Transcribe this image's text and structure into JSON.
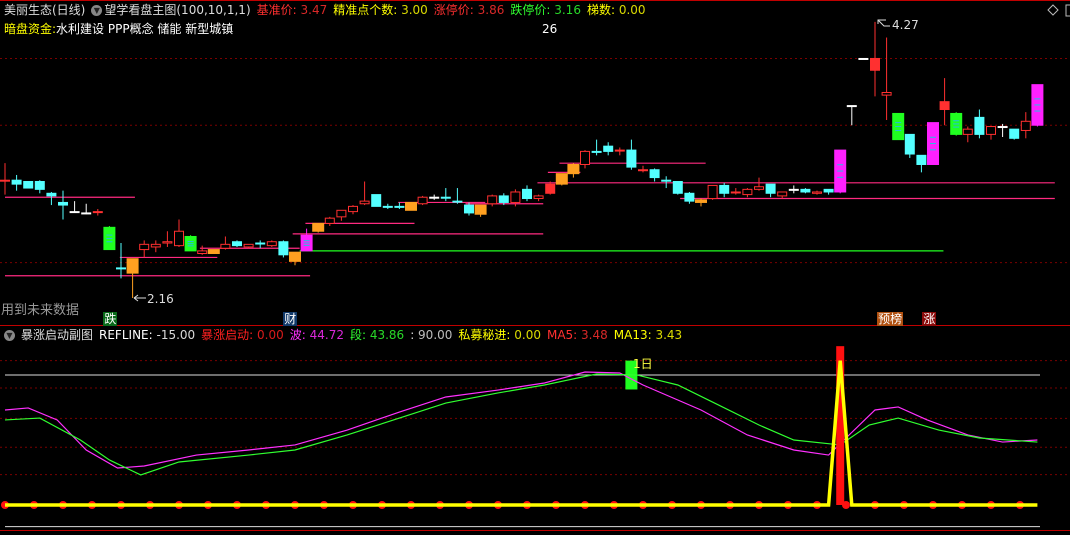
{
  "header": {
    "stock": "美丽生态(日线)",
    "indicator": "望学看盘主图(100,10,1,1)",
    "items": [
      {
        "label": "基准价: ",
        "value": "3.47",
        "color": "#ff3030"
      },
      {
        "label": "精准点个数: ",
        "value": "3.00",
        "color": "#ffff00"
      },
      {
        "label": "涨停价: ",
        "value": "3.86",
        "color": "#ff3030"
      },
      {
        "label": "跌停价: ",
        "value": "3.16",
        "color": "#30ff30"
      },
      {
        "label": "梯数: ",
        "value": "0.00",
        "color": "#ffff00"
      }
    ],
    "concept_label": "暗盘资金:",
    "concepts": "水利建设 PPP概念 储能 新型城镇",
    "number": "26"
  },
  "sub_header": {
    "title": "暴涨启动副图",
    "items": [
      {
        "label": "REFLINE: ",
        "value": "-15.00",
        "color": "#ffffff"
      },
      {
        "label": "暴涨启动: ",
        "value": "0.00",
        "color": "#ff2020"
      },
      {
        "label": "波: ",
        "value": "44.72",
        "color": "#ff30ff"
      },
      {
        "label": "段: ",
        "value": "43.86",
        "color": "#30ff30"
      },
      {
        "label": ": ",
        "value": "90.00",
        "color": "#dddddd"
      },
      {
        "label": "私募秘进: ",
        "value": "0.00",
        "color": "#ffff00"
      },
      {
        "label": "MA5: ",
        "value": "3.48",
        "color": "#ff3030"
      },
      {
        "label": "MA13: ",
        "value": "3.43",
        "color": "#ffff00"
      }
    ]
  },
  "annotations": {
    "high_label": "4.27",
    "low_label": "2.16",
    "future_data_note": "用到未来数据",
    "tags": [
      {
        "text": "跌",
        "bg": "#0a6a1a",
        "index": 9
      },
      {
        "text": "财",
        "bg": "#123a6a",
        "index": 24.5
      },
      {
        "text": "预榜",
        "bg": "#b05010",
        "index": 75.7
      },
      {
        "text": "涨",
        "bg": "#8a0a0a",
        "index": 79.6
      }
    ],
    "sub_marker_label": "1日"
  },
  "colors": {
    "up": "#ff3030",
    "down": "#54ffff",
    "flat": "#ffffff",
    "orange": "#ffa020",
    "green": "#20ff20",
    "magenta": "#ff20ff",
    "level": "#ff2a80",
    "grid": "#7a0000"
  },
  "chart_data": [
    {
      "type": "candlestick",
      "ylim": [
        1.95,
        4.44
      ],
      "high_point": 4.27,
      "low_point": 2.16,
      "candle_fields": [
        "open",
        "high",
        "low",
        "close",
        "style"
      ],
      "candles": [
        [
          3.06,
          3.19,
          2.95,
          3.06,
          "up"
        ],
        [
          3.06,
          3.1,
          2.98,
          3.03,
          "dn"
        ],
        [
          3.05,
          3.05,
          3.0,
          3.0,
          "dn"
        ],
        [
          3.05,
          3.06,
          2.96,
          2.99,
          "dn"
        ],
        [
          2.96,
          2.97,
          2.87,
          2.94,
          "dn"
        ],
        [
          2.89,
          2.98,
          2.76,
          2.87,
          "dn"
        ],
        [
          2.82,
          2.9,
          2.82,
          2.82,
          "flat"
        ],
        [
          2.81,
          2.88,
          2.8,
          2.81,
          "flat"
        ],
        [
          2.82,
          2.84,
          2.79,
          2.82,
          "up"
        ],
        [
          2.7,
          2.71,
          2.53,
          2.53,
          "gr"
        ],
        [
          2.39,
          2.58,
          2.31,
          2.39,
          "dn"
        ],
        [
          2.35,
          2.46,
          2.16,
          2.46,
          "or"
        ],
        [
          2.53,
          2.6,
          2.47,
          2.57,
          "up"
        ],
        [
          2.55,
          2.6,
          2.51,
          2.57,
          "up"
        ],
        [
          2.58,
          2.67,
          2.55,
          2.59,
          "up"
        ],
        [
          2.56,
          2.76,
          2.55,
          2.67,
          "up"
        ],
        [
          2.63,
          2.64,
          2.52,
          2.52,
          "gr"
        ],
        [
          2.5,
          2.56,
          2.49,
          2.52,
          "up"
        ],
        [
          2.5,
          2.53,
          2.5,
          2.53,
          "or"
        ],
        [
          2.54,
          2.63,
          2.53,
          2.57,
          "up"
        ],
        [
          2.59,
          2.6,
          2.55,
          2.56,
          "dn"
        ],
        [
          2.55,
          2.57,
          2.54,
          2.57,
          "up"
        ],
        [
          2.58,
          2.6,
          2.54,
          2.58,
          "dn"
        ],
        [
          2.56,
          2.6,
          2.55,
          2.59,
          "up"
        ],
        [
          2.59,
          2.6,
          2.47,
          2.49,
          "dn"
        ],
        [
          2.51,
          2.51,
          2.41,
          2.44,
          "or"
        ],
        [
          2.52,
          2.69,
          2.52,
          2.64,
          "mg"
        ],
        [
          2.67,
          2.73,
          2.66,
          2.73,
          "or"
        ],
        [
          2.73,
          2.78,
          2.71,
          2.77,
          "up"
        ],
        [
          2.78,
          2.83,
          2.75,
          2.83,
          "up"
        ],
        [
          2.82,
          2.87,
          2.8,
          2.86,
          "up"
        ],
        [
          2.88,
          3.05,
          2.87,
          2.9,
          "up"
        ],
        [
          2.95,
          2.95,
          2.86,
          2.86,
          "dn"
        ],
        [
          2.86,
          2.88,
          2.84,
          2.86,
          "dn"
        ],
        [
          2.86,
          2.89,
          2.84,
          2.86,
          "dn"
        ],
        [
          2.83,
          2.89,
          2.83,
          2.89,
          "or"
        ],
        [
          2.88,
          2.94,
          2.87,
          2.93,
          "up"
        ],
        [
          2.93,
          2.95,
          2.91,
          2.93,
          "flat"
        ],
        [
          2.93,
          3.0,
          2.9,
          2.93,
          "dn"
        ],
        [
          2.9,
          3.0,
          2.88,
          2.9,
          "dn"
        ],
        [
          2.87,
          2.89,
          2.79,
          2.81,
          "dn"
        ],
        [
          2.8,
          2.87,
          2.78,
          2.87,
          "or"
        ],
        [
          2.88,
          2.95,
          2.86,
          2.94,
          "up"
        ],
        [
          2.94,
          2.96,
          2.87,
          2.89,
          "dn"
        ],
        [
          2.89,
          2.99,
          2.86,
          2.97,
          "up"
        ],
        [
          2.99,
          3.02,
          2.9,
          2.92,
          "dn"
        ],
        [
          2.92,
          2.95,
          2.9,
          2.94,
          "up"
        ],
        [
          2.96,
          3.05,
          2.95,
          3.03,
          "rf"
        ],
        [
          3.03,
          3.11,
          3.02,
          3.11,
          "or"
        ],
        [
          3.11,
          3.19,
          3.08,
          3.18,
          "or"
        ],
        [
          3.18,
          3.29,
          3.15,
          3.28,
          "up"
        ],
        [
          3.28,
          3.37,
          3.25,
          3.28,
          "dn"
        ],
        [
          3.32,
          3.35,
          3.25,
          3.28,
          "dn"
        ],
        [
          3.29,
          3.31,
          3.25,
          3.29,
          "up"
        ],
        [
          3.29,
          3.37,
          3.14,
          3.16,
          "dn"
        ],
        [
          3.14,
          3.17,
          3.12,
          3.14,
          "up"
        ],
        [
          3.14,
          3.15,
          3.05,
          3.08,
          "dn"
        ],
        [
          3.06,
          3.09,
          3.0,
          3.06,
          "dn"
        ],
        [
          3.05,
          3.05,
          2.95,
          2.96,
          "dn"
        ],
        [
          2.96,
          2.97,
          2.88,
          2.9,
          "dn"
        ],
        [
          2.89,
          2.92,
          2.86,
          2.91,
          "or"
        ],
        [
          2.92,
          3.02,
          2.91,
          3.02,
          "up"
        ],
        [
          3.02,
          3.04,
          2.93,
          2.96,
          "dn"
        ],
        [
          2.97,
          3.0,
          2.95,
          2.97,
          "up"
        ],
        [
          2.95,
          3.0,
          2.93,
          2.99,
          "up"
        ],
        [
          2.99,
          3.08,
          2.98,
          3.01,
          "up"
        ],
        [
          3.03,
          3.03,
          2.93,
          2.96,
          "dn"
        ],
        [
          2.94,
          2.97,
          2.92,
          2.97,
          "up"
        ],
        [
          2.99,
          3.02,
          2.96,
          2.99,
          "flat"
        ],
        [
          2.99,
          3.0,
          2.96,
          2.97,
          "dn"
        ],
        [
          2.96,
          2.98,
          2.95,
          2.97,
          "up"
        ],
        [
          2.99,
          2.99,
          2.95,
          2.97,
          "dn"
        ],
        [
          2.97,
          3.29,
          2.96,
          3.29,
          "mg"
        ],
        [
          3.63,
          3.63,
          3.48,
          3.63,
          "flat"
        ],
        [
          3.99,
          3.99,
          3.99,
          3.99,
          "flat"
        ],
        [
          3.9,
          4.27,
          3.7,
          3.99,
          "rf"
        ],
        [
          3.71,
          4.15,
          3.52,
          3.73,
          "up"
        ],
        [
          3.57,
          3.57,
          3.37,
          3.37,
          "gr"
        ],
        [
          3.41,
          3.41,
          3.23,
          3.26,
          "dn"
        ],
        [
          3.25,
          3.25,
          3.12,
          3.18,
          "dn"
        ],
        [
          3.18,
          3.5,
          3.18,
          3.5,
          "mg"
        ],
        [
          3.6,
          3.84,
          3.48,
          3.66,
          "rf"
        ],
        [
          3.57,
          3.58,
          3.4,
          3.41,
          "gr"
        ],
        [
          3.41,
          3.47,
          3.35,
          3.45,
          "up"
        ],
        [
          3.54,
          3.6,
          3.38,
          3.41,
          "dn"
        ],
        [
          3.41,
          3.47,
          3.37,
          3.47,
          "up"
        ],
        [
          3.47,
          3.49,
          3.39,
          3.47,
          "flat"
        ],
        [
          3.45,
          3.45,
          3.37,
          3.38,
          "dn"
        ],
        [
          3.44,
          3.58,
          3.38,
          3.51,
          "up"
        ],
        [
          3.48,
          3.79,
          3.47,
          3.79,
          "mg"
        ]
      ],
      "levels": [
        {
          "price": 2.93,
          "from": 0,
          "to": 11.2,
          "color": "#ff2a80"
        },
        {
          "price": 2.33,
          "from": 0,
          "to": 26.3,
          "color": "#ff2a80"
        },
        {
          "price": 2.47,
          "from": 9.9,
          "to": 18.3,
          "color": "#ff2a80"
        },
        {
          "price": 2.54,
          "from": 16.8,
          "to": 25.4,
          "color": "#ff2a80"
        },
        {
          "price": 2.73,
          "from": 25.9,
          "to": 35.3,
          "color": "#ff2a80"
        },
        {
          "price": 2.65,
          "from": 24.8,
          "to": 46.4,
          "color": "#ff2a80"
        },
        {
          "price": 2.89,
          "from": 33.9,
          "to": 41.4,
          "color": "#ff2a80"
        },
        {
          "price": 2.88,
          "from": 39.7,
          "to": 46.4,
          "color": "#ff2a80"
        },
        {
          "price": 3.12,
          "from": 46.8,
          "to": 49.6,
          "color": "#ff2a80"
        },
        {
          "price": 3.19,
          "from": 47.8,
          "to": 60.4,
          "color": "#ff2a80"
        },
        {
          "price": 3.04,
          "from": 45.9,
          "to": 90.5,
          "color": "#ff2a80"
        },
        {
          "price": 2.92,
          "from": 58.2,
          "to": 90.5,
          "color": "#ff2a80"
        },
        {
          "price": 2.52,
          "from": 25.4,
          "to": 80.9,
          "color": "#20ff20"
        }
      ],
      "grid_prices": [
        3.99,
        3.48,
        2.43
      ]
    },
    {
      "type": "line",
      "ylim": [
        -20,
        115
      ],
      "ref_lines": [
        90,
        -15
      ],
      "grid_values": [
        100,
        81,
        60,
        40,
        21
      ],
      "series": [
        {
          "color": "#ff30ff",
          "points": [
            [
              0,
              65.8
            ],
            [
              2,
              67.2
            ],
            [
              4.5,
              58.9
            ],
            [
              7,
              38.1
            ],
            [
              9.7,
              25.6
            ],
            [
              12,
              27.0
            ],
            [
              16.5,
              34.6
            ],
            [
              21,
              38.1
            ],
            [
              25,
              41.6
            ],
            [
              29.5,
              51.9
            ],
            [
              34,
              64.4
            ],
            [
              38,
              74.8
            ],
            [
              42.5,
              79.6
            ],
            [
              46.5,
              84.5
            ],
            [
              50,
              92.1
            ],
            [
              53,
              91.4
            ],
            [
              55,
              83.1
            ],
            [
              60,
              65.8
            ],
            [
              64,
              48.5
            ],
            [
              68,
              38.1
            ],
            [
              71,
              34.6
            ],
            [
              72.5,
              46.4
            ],
            [
              75,
              65.8
            ],
            [
              77,
              67.9
            ],
            [
              79.5,
              58.9
            ],
            [
              83,
              48.5
            ],
            [
              86,
              43.6
            ],
            [
              89,
              45.0
            ]
          ]
        },
        {
          "color": "#30ff30",
          "points": [
            [
              0,
              58.9
            ],
            [
              3,
              60.2
            ],
            [
              6.5,
              45.0
            ],
            [
              9,
              31.2
            ],
            [
              11.7,
              20.8
            ],
            [
              15,
              29.8
            ],
            [
              21,
              34.6
            ],
            [
              25,
              38.1
            ],
            [
              29.5,
              48.5
            ],
            [
              34,
              60.2
            ],
            [
              38,
              70.6
            ],
            [
              42.5,
              77.6
            ],
            [
              46.5,
              83.1
            ],
            [
              51,
              90.7
            ],
            [
              54.5,
              90.0
            ],
            [
              58,
              83.1
            ],
            [
              61.5,
              69.3
            ],
            [
              65,
              55.4
            ],
            [
              68,
              45.0
            ],
            [
              72,
              41.6
            ],
            [
              74.5,
              55.4
            ],
            [
              77,
              60.2
            ],
            [
              80.5,
              51.9
            ],
            [
              84,
              46.4
            ],
            [
              89,
              43.6
            ]
          ]
        }
      ],
      "yellow_signal": {
        "base": 0,
        "spike_index": 72,
        "spike_value": 100
      },
      "red_bar": {
        "index": 72,
        "value": 110
      },
      "green_marker": {
        "index": 54,
        "from": 80,
        "to": 100
      }
    }
  ]
}
